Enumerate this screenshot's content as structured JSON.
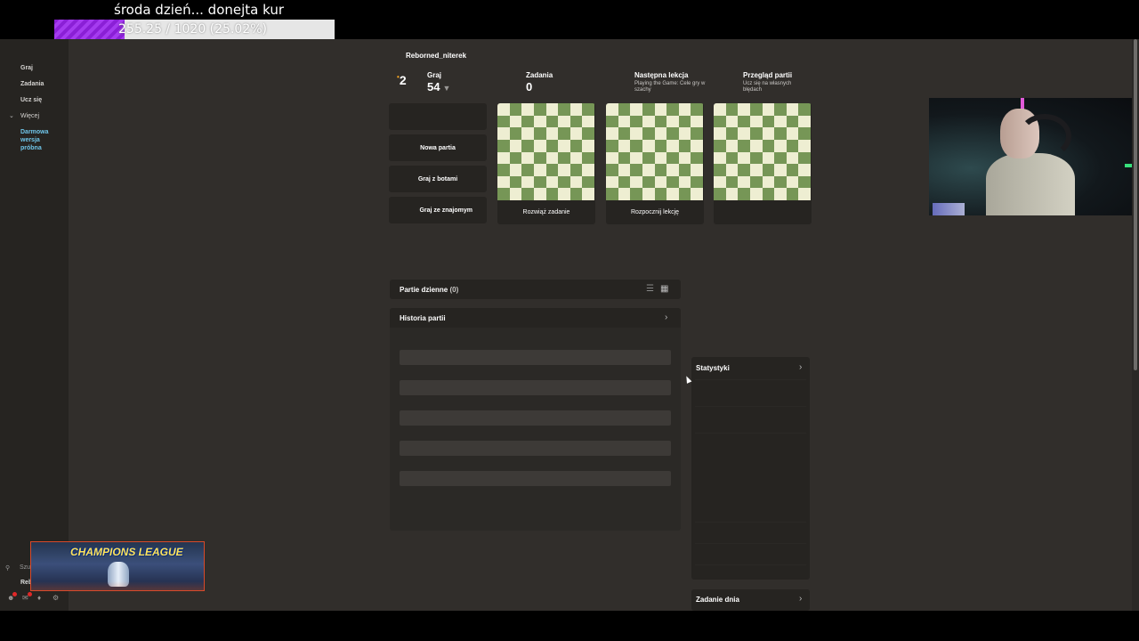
{
  "overlay": {
    "goal_title": "środa dzień... donejta kur",
    "goal_text": "255.25 / 1020 (25.02%)",
    "goal_fraction": 0.2502,
    "banner_text": "CHAMPIONS LEAGUE"
  },
  "sidebar": {
    "items": [
      {
        "label": "Graj"
      },
      {
        "label": "Zadania"
      },
      {
        "label": "Ucz się"
      },
      {
        "label": "Więcej"
      }
    ],
    "free_trial": "Darmowa wersja próbna",
    "search_label": "Szu",
    "user_label": "Reb"
  },
  "profile": {
    "username": "Reborned_niterek",
    "streak": "2",
    "play_label": "Graj",
    "play_value": "54",
    "puzzles_label": "Zadania",
    "puzzles_value": "0",
    "next_lesson_label": "Następna lekcja",
    "next_lesson_sub": "Playing the Game: Cele gry w szachy",
    "review_label": "Przegląd partii",
    "review_sub": "Ucz się na własnych błędach"
  },
  "actions": {
    "new_game": "Nowa partia",
    "play_bots": "Graj z botami",
    "play_friend": "Graj ze znajomym"
  },
  "cards": {
    "solve_puzzle": "Rozwiąż zadanie",
    "start_lesson": "Rozpocznij lekcję"
  },
  "daily_games": {
    "title": "Partie dzienne",
    "count": "(0)"
  },
  "history": {
    "title": "Historia partii"
  },
  "stats": {
    "title": "Statystyki"
  },
  "daily_puzzle": {
    "title": "Zadanie dnia"
  },
  "colors": {
    "board_light": "#eeeed2",
    "board_dark": "#769656",
    "page_bg": "#312e2b",
    "sidebar_bg": "#262421",
    "accent_purple": "#8a1fd6",
    "trial_blue": "#6fc5e9"
  }
}
